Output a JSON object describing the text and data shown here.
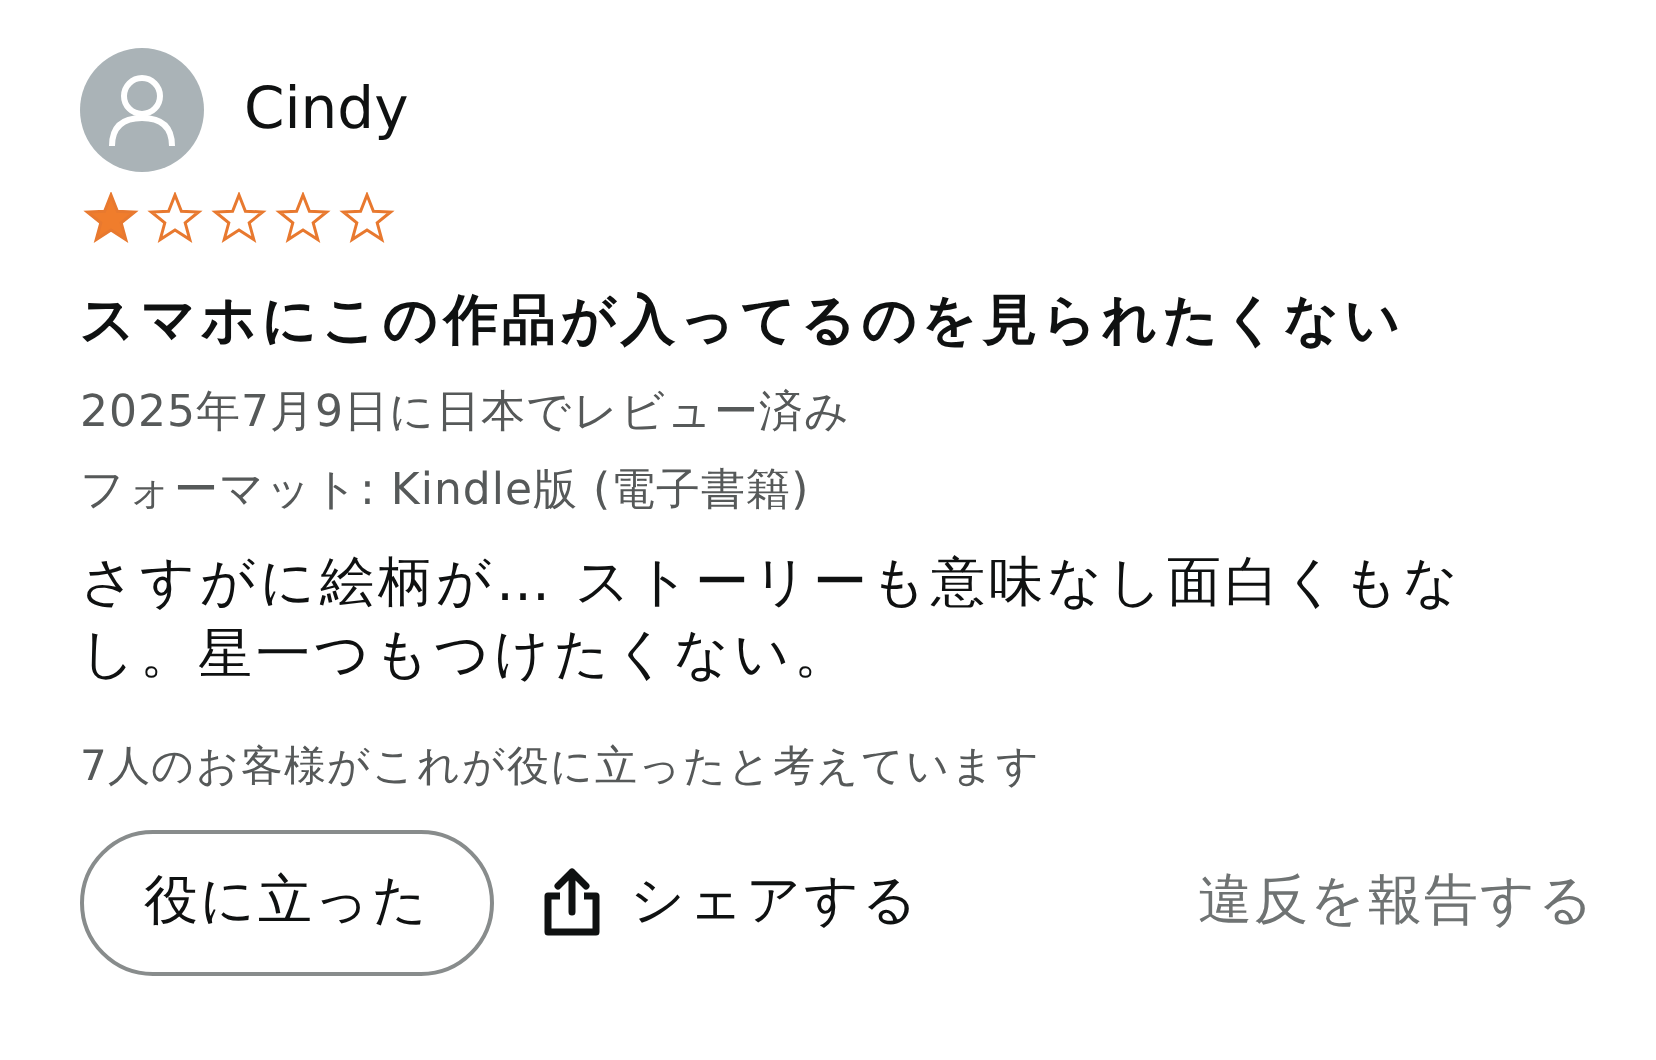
{
  "reviewer": {
    "name": "Cindy"
  },
  "rating": {
    "stars": 1
  },
  "title": "スマホにこの作品が入ってるのを見られたくない",
  "date": "2025年7月9日に日本でレビュー済み",
  "format": "フォーマット: Kindle版 (電子書籍)",
  "body": "さすがに絵柄が… ストーリーも意味なし面白くもなし。星一つもつけたくない。",
  "helpful_count": "7人のお客様がこれが役に立ったと考えています",
  "actions": {
    "helpful": "役に立った",
    "share": "シェアする",
    "report": "違反を報告する"
  }
}
